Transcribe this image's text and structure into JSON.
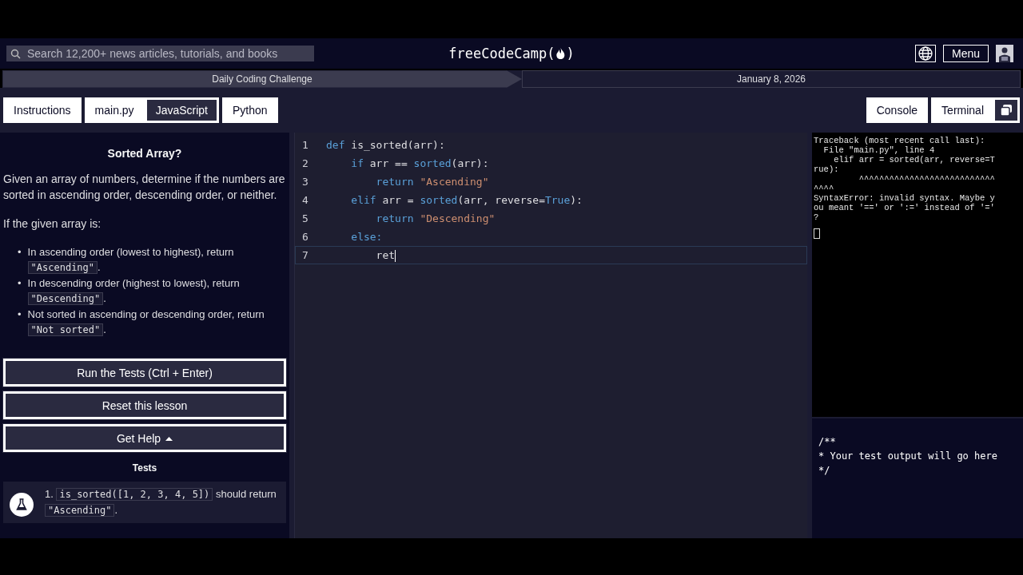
{
  "header": {
    "search": {
      "placeholder": "Search 12,200+ news articles, tutorials, and books"
    },
    "logo": {
      "before": "freeCodeCamp(",
      "after": ")"
    },
    "menu_button": "Menu"
  },
  "breadcrumb": [
    "Daily Coding Challenge",
    "January 8, 2026"
  ],
  "left_tab_groups": [
    [
      {
        "label": "Instructions",
        "selected": true
      }
    ],
    [
      {
        "label": "main.py",
        "selected": true
      },
      {
        "label": "JavaScript",
        "selected": false
      }
    ],
    [
      {
        "label": "Python",
        "selected": true
      }
    ]
  ],
  "right_tabs": [
    {
      "label": "Console",
      "selected": true
    },
    {
      "label": "Terminal",
      "selected": true
    }
  ],
  "instructions": {
    "title": "Sorted Array?",
    "paragraphs": [
      "Given an array of numbers, determine if the numbers are sorted in ascending order, descending order, or neither.",
      "If the given array is:"
    ],
    "bullets": [
      {
        "marker": "•",
        "text": "In ascending order (lowest to highest), return",
        "code": "\"Ascending\"",
        "after": "."
      },
      {
        "marker": "•",
        "text": "In descending order (highest to lowest), return",
        "code": "\"Descending\"",
        "after": "."
      },
      {
        "marker": "•",
        "text": "Not sorted in ascending or descending order, return",
        "code": "\"Not sorted\"",
        "after": "."
      }
    ]
  },
  "buttons": [
    {
      "label": "Run the Tests (Ctrl + Enter)",
      "kind": "plain"
    },
    {
      "label": "Reset this lesson",
      "kind": "plain"
    },
    {
      "label": "Get Help",
      "kind": "dropdown"
    }
  ],
  "tests": {
    "title": "Tests",
    "items": [
      {
        "number": "1.",
        "code": "is_sorted([1, 2, 3, 4, 5])",
        "middle": "should",
        "word": "return",
        "result": "\"Ascending\"",
        "after": "."
      }
    ]
  },
  "editor": {
    "lines": [
      {
        "number": "1",
        "active": false,
        "tokens": [
          {
            "text": "def",
            "kind": "keyword"
          },
          {
            "text": " is_sorted(arr):",
            "kind": "plain"
          }
        ]
      },
      {
        "number": "2",
        "active": false,
        "tokens": [
          {
            "text": "    if",
            "kind": "keyword"
          },
          {
            "text": " arr == ",
            "kind": "plain"
          },
          {
            "text": "sorted",
            "kind": "builtin"
          },
          {
            "text": "(arr):",
            "kind": "plain"
          }
        ]
      },
      {
        "number": "3",
        "active": false,
        "tokens": [
          {
            "text": "        return ",
            "kind": "keyword"
          },
          {
            "text": "\"Ascending\"",
            "kind": "string"
          }
        ]
      },
      {
        "number": "4",
        "active": false,
        "tokens": [
          {
            "text": "    elif",
            "kind": "keyword"
          },
          {
            "text": " arr = ",
            "kind": "plain"
          },
          {
            "text": "sorted",
            "kind": "builtin"
          },
          {
            "text": "(arr, reverse=",
            "kind": "plain"
          },
          {
            "text": "True",
            "kind": "keyword"
          },
          {
            "text": "):",
            "kind": "plain"
          }
        ]
      },
      {
        "number": "5",
        "active": false,
        "tokens": [
          {
            "text": "        return ",
            "kind": "keyword"
          },
          {
            "text": "\"Descending\"",
            "kind": "string"
          }
        ]
      },
      {
        "number": "6",
        "active": false,
        "tokens": [
          {
            "text": "    else:",
            "kind": "keyword"
          }
        ]
      },
      {
        "number": "7",
        "active": true,
        "tokens": [
          {
            "text": "        ret",
            "kind": "plain"
          }
        ]
      }
    ]
  },
  "terminal": {
    "lines": [
      "Traceback (most recent call last):",
      "  File \"main.py\", line 4",
      "    elif arr = sorted(arr, reverse=T",
      "rue):",
      "         ^^^^^^^^^^^^^^^^^^^^^^^^^^^",
      "^^^^",
      "SyntaxError: invalid syntax. Maybe y",
      "ou meant '==' or ':=' instead of '='",
      "?"
    ]
  },
  "test_output": [
    "/**",
    "* Your test output will go here",
    "*/"
  ]
}
